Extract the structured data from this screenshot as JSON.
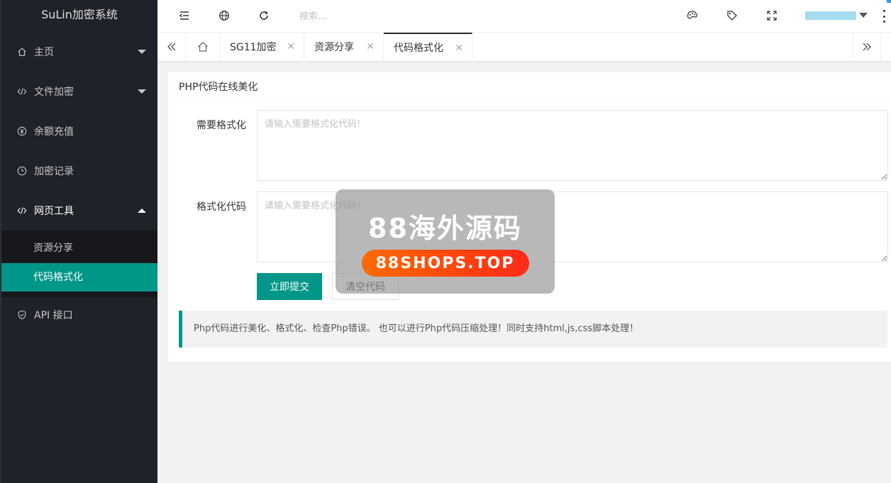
{
  "app": {
    "title": "SuLin加密系统"
  },
  "sidebar": {
    "items": [
      {
        "label": "主页",
        "icon": "home-icon"
      },
      {
        "label": "文件加密",
        "icon": "code-icon"
      },
      {
        "label": "余额充值",
        "icon": "yen-icon"
      },
      {
        "label": "加密记录",
        "icon": "clock-icon"
      },
      {
        "label": "网页工具",
        "icon": "code-icon"
      },
      {
        "label": "API 接口",
        "icon": "shield-icon"
      }
    ],
    "subitems": [
      {
        "label": "资源分享"
      },
      {
        "label": "代码格式化"
      }
    ]
  },
  "header": {
    "search_placeholder": "搜索..."
  },
  "tabs": [
    {
      "label": "SG11加密"
    },
    {
      "label": "资源分享"
    },
    {
      "label": "代码格式化"
    }
  ],
  "main": {
    "card_title": "PHP代码在线美化",
    "field1_label": "需要格式化",
    "field1_placeholder": "请输入需要格式化代码!",
    "field2_label": "格式化代码",
    "field2_placeholder": "请输入需要格式化代码!",
    "submit_label": "立即提交",
    "clear_label": "清空代码",
    "note": "Php代码进行美化、格式化、检查Php错误。 也可以进行Php代码压缩处理！同时支持html,js,css脚本处理！"
  },
  "watermark": {
    "title": "88海外源码",
    "pill": "88SHOPS.TOP"
  },
  "colors": {
    "sidebar_bg": "#20222a",
    "accent": "#009688",
    "tab_active_border": "#292b34"
  }
}
